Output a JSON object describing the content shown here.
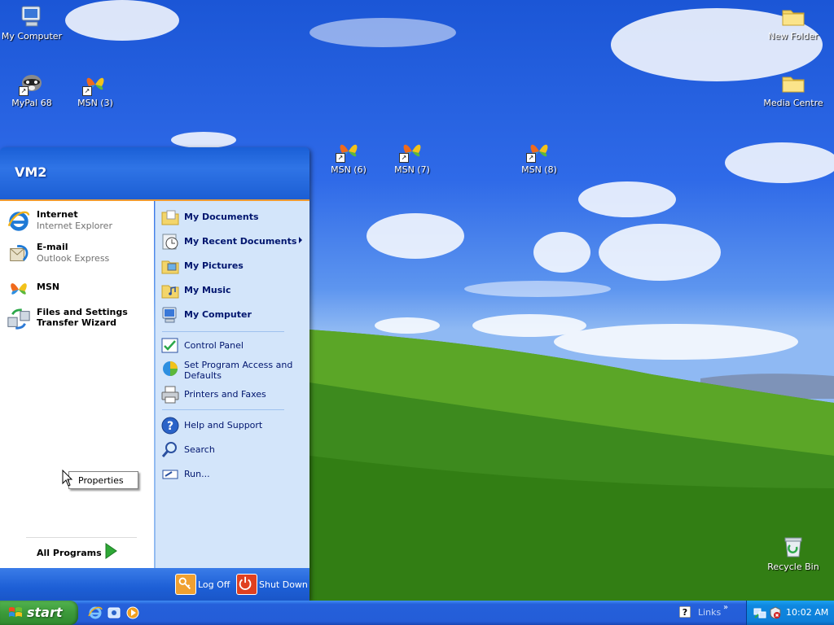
{
  "desktop": {
    "icons": [
      {
        "label": "My Computer"
      },
      {
        "label": "MyPal 68"
      },
      {
        "label": "MSN (3)"
      },
      {
        "label": "MSN (6)"
      },
      {
        "label": "MSN (7)"
      },
      {
        "label": "MSN (8)"
      },
      {
        "label": "New Folder"
      },
      {
        "label": "Media Centre"
      },
      {
        "label": "Recycle Bin"
      }
    ]
  },
  "start_menu": {
    "user": "VM2",
    "pinned": [
      {
        "title": "Internet",
        "subtitle": "Internet Explorer"
      },
      {
        "title": "E-mail",
        "subtitle": "Outlook Express"
      },
      {
        "title": "MSN"
      },
      {
        "title": "Files and Settings Transfer Wizard"
      }
    ],
    "all_programs": "All Programs",
    "right": [
      {
        "label": "My Documents"
      },
      {
        "label": "My Recent Documents"
      },
      {
        "label": "My Pictures"
      },
      {
        "label": "My Music"
      },
      {
        "label": "My Computer"
      },
      {
        "label": "Control Panel"
      },
      {
        "label": "Set Program Access and Defaults"
      },
      {
        "label": "Printers and Faxes"
      },
      {
        "label": "Help and Support"
      },
      {
        "label": "Search"
      },
      {
        "label": "Run..."
      }
    ],
    "log_off": "Log Off",
    "shut_down": "Shut Down"
  },
  "context_popup": {
    "label": "Properties"
  },
  "taskbar": {
    "start": "start",
    "links": "Links",
    "links_chevron": "»",
    "clock": "10:02 AM"
  },
  "colors": {
    "taskbar_blue": "#245dd8",
    "start_green": "#3c9a3a",
    "menu_right_pane": "#d3e5fa",
    "header_orange_rule": "#ee9a32"
  }
}
